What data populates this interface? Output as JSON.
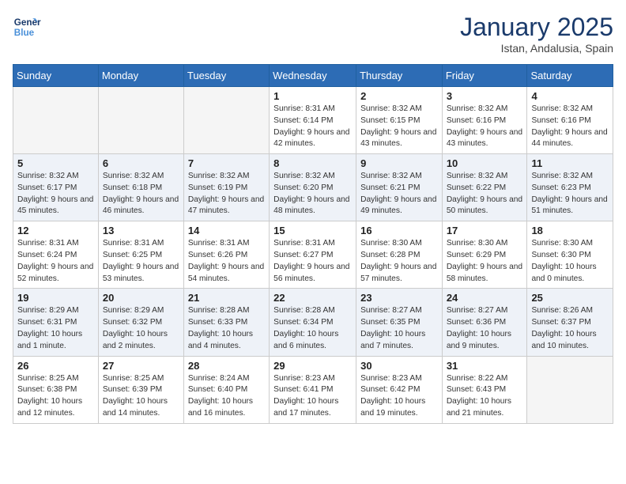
{
  "header": {
    "logo_line1": "General",
    "logo_line2": "Blue",
    "month": "January 2025",
    "location": "Istan, Andalusia, Spain"
  },
  "weekdays": [
    "Sunday",
    "Monday",
    "Tuesday",
    "Wednesday",
    "Thursday",
    "Friday",
    "Saturday"
  ],
  "weeks": [
    [
      {
        "day": "",
        "info": ""
      },
      {
        "day": "",
        "info": ""
      },
      {
        "day": "",
        "info": ""
      },
      {
        "day": "1",
        "info": "Sunrise: 8:31 AM\nSunset: 6:14 PM\nDaylight: 9 hours\nand 42 minutes."
      },
      {
        "day": "2",
        "info": "Sunrise: 8:32 AM\nSunset: 6:15 PM\nDaylight: 9 hours\nand 43 minutes."
      },
      {
        "day": "3",
        "info": "Sunrise: 8:32 AM\nSunset: 6:16 PM\nDaylight: 9 hours\nand 43 minutes."
      },
      {
        "day": "4",
        "info": "Sunrise: 8:32 AM\nSunset: 6:16 PM\nDaylight: 9 hours\nand 44 minutes."
      }
    ],
    [
      {
        "day": "5",
        "info": "Sunrise: 8:32 AM\nSunset: 6:17 PM\nDaylight: 9 hours\nand 45 minutes."
      },
      {
        "day": "6",
        "info": "Sunrise: 8:32 AM\nSunset: 6:18 PM\nDaylight: 9 hours\nand 46 minutes."
      },
      {
        "day": "7",
        "info": "Sunrise: 8:32 AM\nSunset: 6:19 PM\nDaylight: 9 hours\nand 47 minutes."
      },
      {
        "day": "8",
        "info": "Sunrise: 8:32 AM\nSunset: 6:20 PM\nDaylight: 9 hours\nand 48 minutes."
      },
      {
        "day": "9",
        "info": "Sunrise: 8:32 AM\nSunset: 6:21 PM\nDaylight: 9 hours\nand 49 minutes."
      },
      {
        "day": "10",
        "info": "Sunrise: 8:32 AM\nSunset: 6:22 PM\nDaylight: 9 hours\nand 50 minutes."
      },
      {
        "day": "11",
        "info": "Sunrise: 8:32 AM\nSunset: 6:23 PM\nDaylight: 9 hours\nand 51 minutes."
      }
    ],
    [
      {
        "day": "12",
        "info": "Sunrise: 8:31 AM\nSunset: 6:24 PM\nDaylight: 9 hours\nand 52 minutes."
      },
      {
        "day": "13",
        "info": "Sunrise: 8:31 AM\nSunset: 6:25 PM\nDaylight: 9 hours\nand 53 minutes."
      },
      {
        "day": "14",
        "info": "Sunrise: 8:31 AM\nSunset: 6:26 PM\nDaylight: 9 hours\nand 54 minutes."
      },
      {
        "day": "15",
        "info": "Sunrise: 8:31 AM\nSunset: 6:27 PM\nDaylight: 9 hours\nand 56 minutes."
      },
      {
        "day": "16",
        "info": "Sunrise: 8:30 AM\nSunset: 6:28 PM\nDaylight: 9 hours\nand 57 minutes."
      },
      {
        "day": "17",
        "info": "Sunrise: 8:30 AM\nSunset: 6:29 PM\nDaylight: 9 hours\nand 58 minutes."
      },
      {
        "day": "18",
        "info": "Sunrise: 8:30 AM\nSunset: 6:30 PM\nDaylight: 10 hours\nand 0 minutes."
      }
    ],
    [
      {
        "day": "19",
        "info": "Sunrise: 8:29 AM\nSunset: 6:31 PM\nDaylight: 10 hours\nand 1 minute."
      },
      {
        "day": "20",
        "info": "Sunrise: 8:29 AM\nSunset: 6:32 PM\nDaylight: 10 hours\nand 2 minutes."
      },
      {
        "day": "21",
        "info": "Sunrise: 8:28 AM\nSunset: 6:33 PM\nDaylight: 10 hours\nand 4 minutes."
      },
      {
        "day": "22",
        "info": "Sunrise: 8:28 AM\nSunset: 6:34 PM\nDaylight: 10 hours\nand 6 minutes."
      },
      {
        "day": "23",
        "info": "Sunrise: 8:27 AM\nSunset: 6:35 PM\nDaylight: 10 hours\nand 7 minutes."
      },
      {
        "day": "24",
        "info": "Sunrise: 8:27 AM\nSunset: 6:36 PM\nDaylight: 10 hours\nand 9 minutes."
      },
      {
        "day": "25",
        "info": "Sunrise: 8:26 AM\nSunset: 6:37 PM\nDaylight: 10 hours\nand 10 minutes."
      }
    ],
    [
      {
        "day": "26",
        "info": "Sunrise: 8:25 AM\nSunset: 6:38 PM\nDaylight: 10 hours\nand 12 minutes."
      },
      {
        "day": "27",
        "info": "Sunrise: 8:25 AM\nSunset: 6:39 PM\nDaylight: 10 hours\nand 14 minutes."
      },
      {
        "day": "28",
        "info": "Sunrise: 8:24 AM\nSunset: 6:40 PM\nDaylight: 10 hours\nand 16 minutes."
      },
      {
        "day": "29",
        "info": "Sunrise: 8:23 AM\nSunset: 6:41 PM\nDaylight: 10 hours\nand 17 minutes."
      },
      {
        "day": "30",
        "info": "Sunrise: 8:23 AM\nSunset: 6:42 PM\nDaylight: 10 hours\nand 19 minutes."
      },
      {
        "day": "31",
        "info": "Sunrise: 8:22 AM\nSunset: 6:43 PM\nDaylight: 10 hours\nand 21 minutes."
      },
      {
        "day": "",
        "info": ""
      }
    ]
  ]
}
